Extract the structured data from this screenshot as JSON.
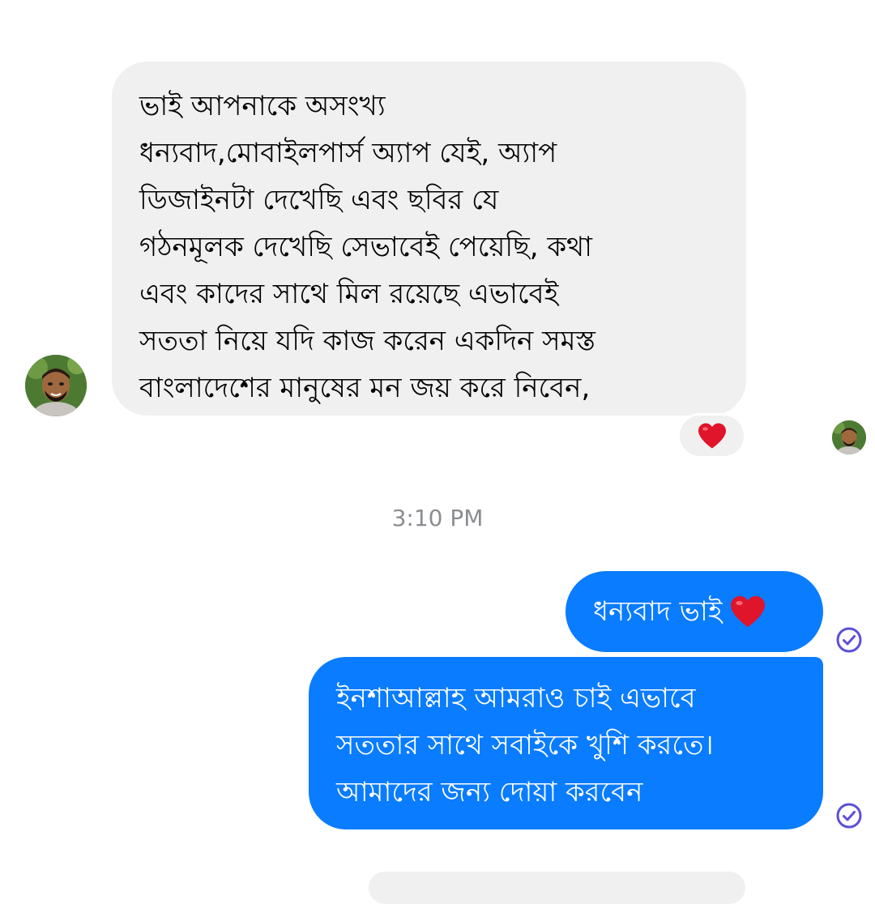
{
  "conversation": {
    "incoming_message": {
      "lines": [
        "ভাই আপনাকে অসংখ্য",
        "ধন্যবাদ,মোবাইলপার্স  অ্যাপ  যেই, অ্যাপ",
        "ডিজাইনটা দেখেছি এবং ছবির যে",
        "গঠনমূলক দেখেছি সেভাবেই পেয়েছি, কথা",
        "এবং কাদের সাথে মিল রয়েছে এভাবেই",
        "সততা নিয়ে যদি কাজ করেন একদিন সমস্ত",
        "বাংলাদেশের মানুষের মন জয় করে নিবেন,"
      ],
      "reaction": "heart"
    },
    "timestamp": "3:10 PM",
    "outgoing_messages": [
      {
        "text": "ধন্যবাদ ভাই",
        "emoji": "heart"
      },
      {
        "lines": [
          "ইনশাআল্লাহ আমরাও চাই এভাবে",
          "সততার সাথে সবাইকে খুশি করতে।",
          "আমাদের জন্য দোয়া করবেন"
        ]
      }
    ]
  },
  "colors": {
    "incoming_bubble": "#f0f0f0",
    "outgoing_bubble": "#0a7cff",
    "timestamp_text": "#8a8d91",
    "read_receipt": "#5b4fd8",
    "heart": "#e0142a"
  },
  "icons": {
    "reaction": "heart-icon",
    "read_receipt": "check-circle-icon"
  }
}
